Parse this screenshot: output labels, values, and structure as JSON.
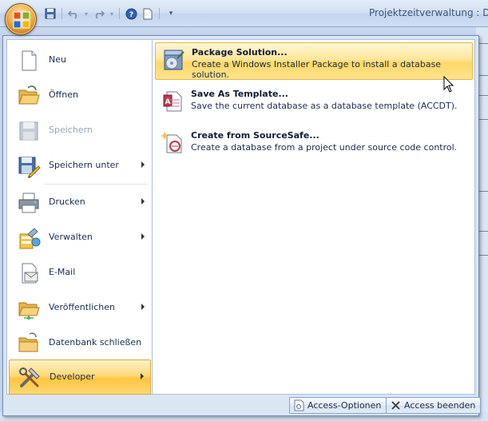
{
  "window": {
    "title": "Projektzeitverwaltung : Da"
  },
  "qat": {
    "icons": [
      "save-icon",
      "undo-icon",
      "redo-icon",
      "help-icon",
      "new-document-icon",
      "customize-icon"
    ]
  },
  "menu": {
    "items": [
      {
        "label": "Neu",
        "icon": "new-document-icon",
        "disabled": false,
        "submenu": false
      },
      {
        "label": "Öffnen",
        "icon": "open-folder-icon",
        "disabled": false,
        "submenu": false
      },
      {
        "label": "Speichern",
        "icon": "save-icon",
        "disabled": true,
        "submenu": false
      },
      {
        "label": "Speichern unter",
        "icon": "save-as-icon",
        "disabled": false,
        "submenu": true
      },
      {
        "label": "Drucken",
        "icon": "printer-icon",
        "disabled": false,
        "submenu": true
      },
      {
        "label": "Verwalten",
        "icon": "manage-icon",
        "disabled": false,
        "submenu": true
      },
      {
        "label": "E-Mail",
        "icon": "email-icon",
        "disabled": false,
        "submenu": false
      },
      {
        "label": "Veröffentlichen",
        "icon": "publish-icon",
        "disabled": false,
        "submenu": true
      },
      {
        "label": "Datenbank schließen",
        "icon": "close-database-icon",
        "disabled": false,
        "submenu": false
      },
      {
        "label": "Developer",
        "icon": "developer-tools-icon",
        "disabled": false,
        "submenu": true,
        "selected": true
      }
    ],
    "submenu": [
      {
        "title": "Package Solution...",
        "desc": "Create a Windows Installer Package to install a database solution.",
        "icon": "package-icon",
        "selected": true
      },
      {
        "title": "Save As Template...",
        "desc": "Save the current database as a database template (ACCDT).",
        "icon": "template-icon",
        "selected": false
      },
      {
        "title": "Create from SourceSafe...",
        "desc": "Create a database from a project under source code control.",
        "icon": "sourcesafe-icon",
        "selected": false
      }
    ],
    "footer": {
      "options_label": "Access-Optionen",
      "exit_label": "Access beenden"
    }
  },
  "colors": {
    "highlight": "#ffd97a",
    "menu_border": "#6e8bb8",
    "background": "#dbe6f4"
  }
}
